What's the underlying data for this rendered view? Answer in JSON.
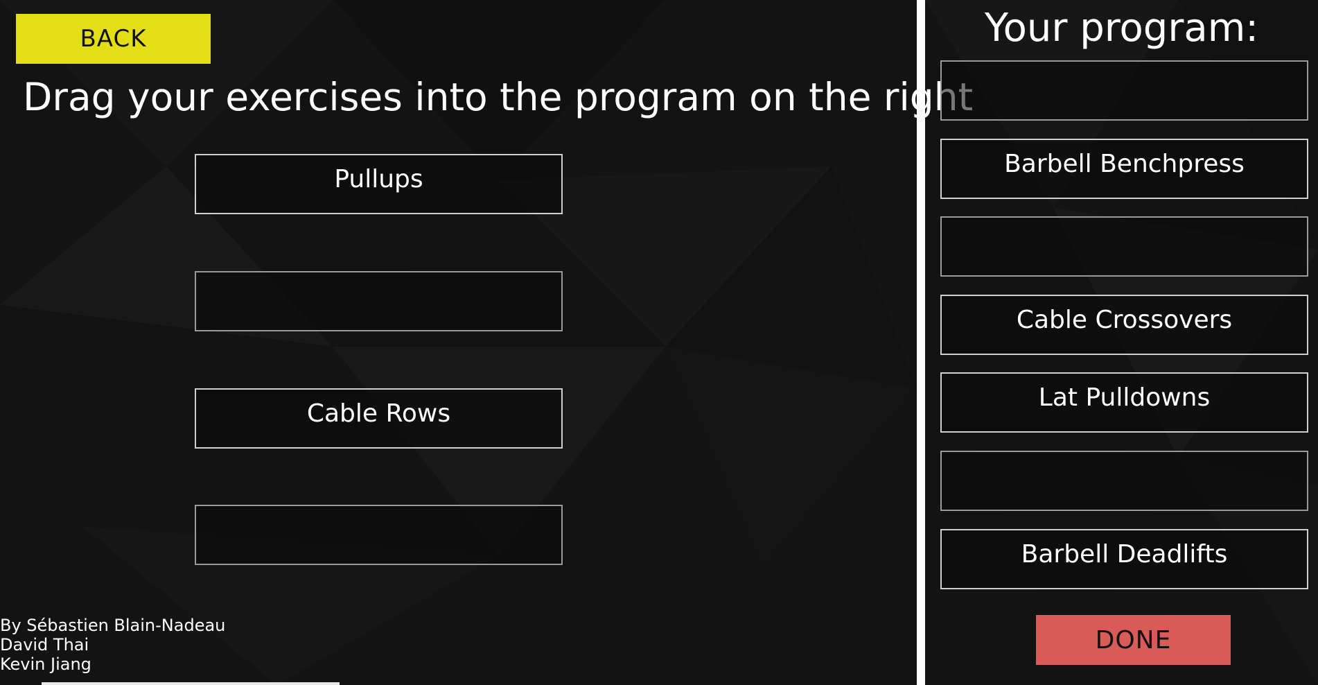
{
  "back_button": {
    "label": "BACK"
  },
  "instructions": "Drag your exercises into the program on the right",
  "exercise_slots": [
    {
      "label": "Pullups"
    },
    {
      "label": ""
    },
    {
      "label": "Cable Rows"
    },
    {
      "label": ""
    }
  ],
  "program": {
    "title": "Your program:",
    "slots": [
      {
        "label": ""
      },
      {
        "label": "Barbell Benchpress"
      },
      {
        "label": ""
      },
      {
        "label": "Cable Crossovers"
      },
      {
        "label": "Lat Pulldowns"
      },
      {
        "label": ""
      },
      {
        "label": "Barbell Deadlifts"
      }
    ]
  },
  "done_button": {
    "label": "DONE"
  },
  "credits": {
    "line1": "By Sébastien Blain-Nadeau",
    "line2": "David Thai",
    "line3": "Kevin Jiang"
  },
  "colors": {
    "background": "#151515",
    "back_button": "#e3de16",
    "done_button": "#d85a59",
    "slot_border": "#cfcfcf"
  }
}
